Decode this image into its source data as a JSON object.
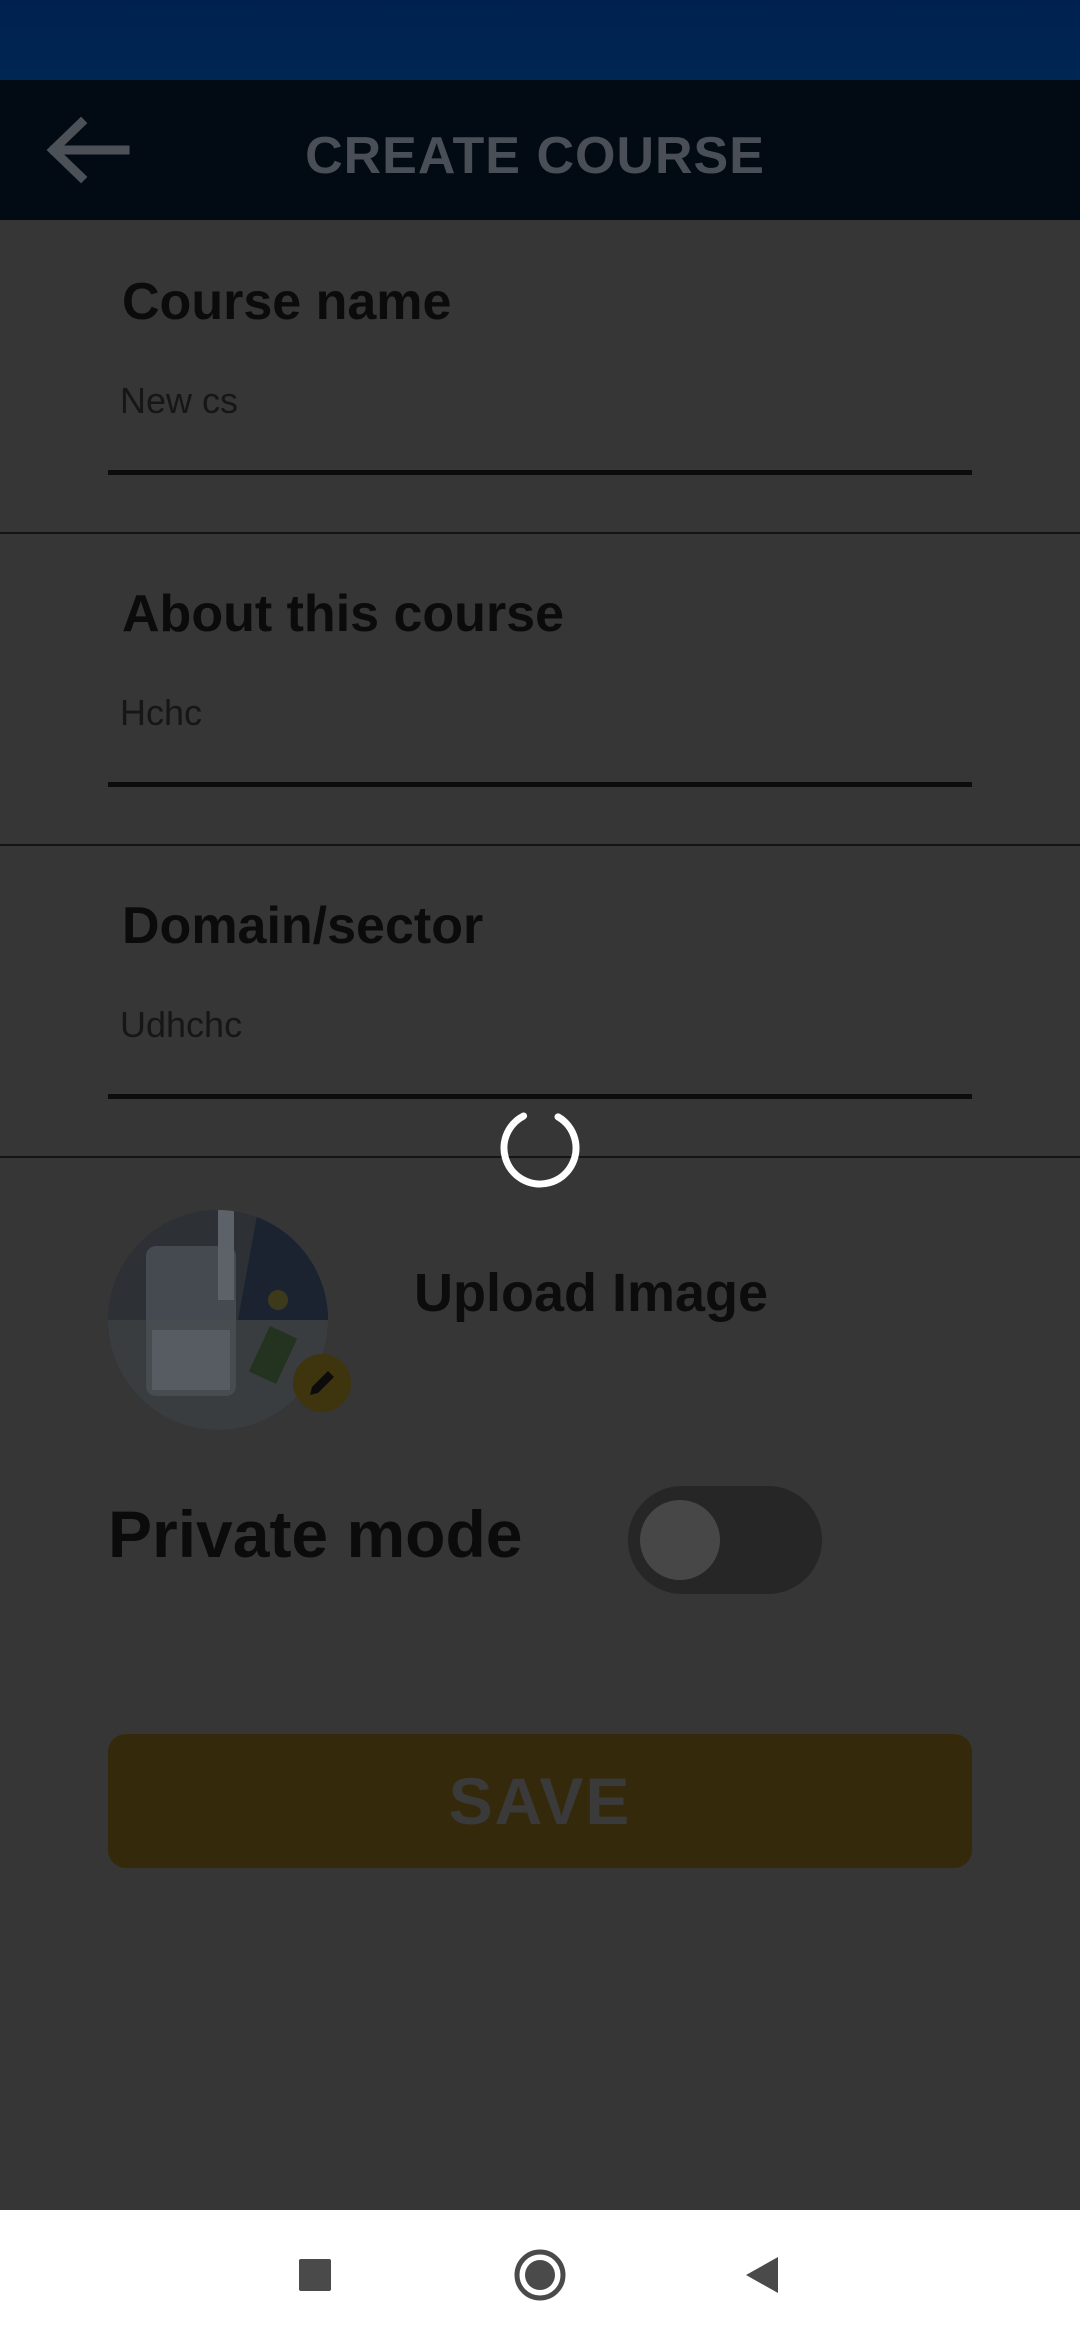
{
  "app_bar": {
    "title": "CREATE COURSE",
    "back_icon": "arrow-left-icon"
  },
  "form": {
    "course_name": {
      "label": "Course name",
      "value": "New cs"
    },
    "about": {
      "label": "About this course",
      "value": "Hchc"
    },
    "domain": {
      "label": "Domain/sector",
      "value": "Udhchc"
    }
  },
  "image": {
    "upload_label": "Upload Image",
    "edit_icon": "pencil-icon"
  },
  "private_mode": {
    "label": "Private mode",
    "enabled": false
  },
  "save_label": "SAVE",
  "loading": true,
  "colors": {
    "accent": "#f5c518",
    "primary": "#003a80"
  },
  "nav": {
    "icons": [
      "recents-square-icon",
      "home-circle-icon",
      "back-triangle-icon"
    ]
  }
}
